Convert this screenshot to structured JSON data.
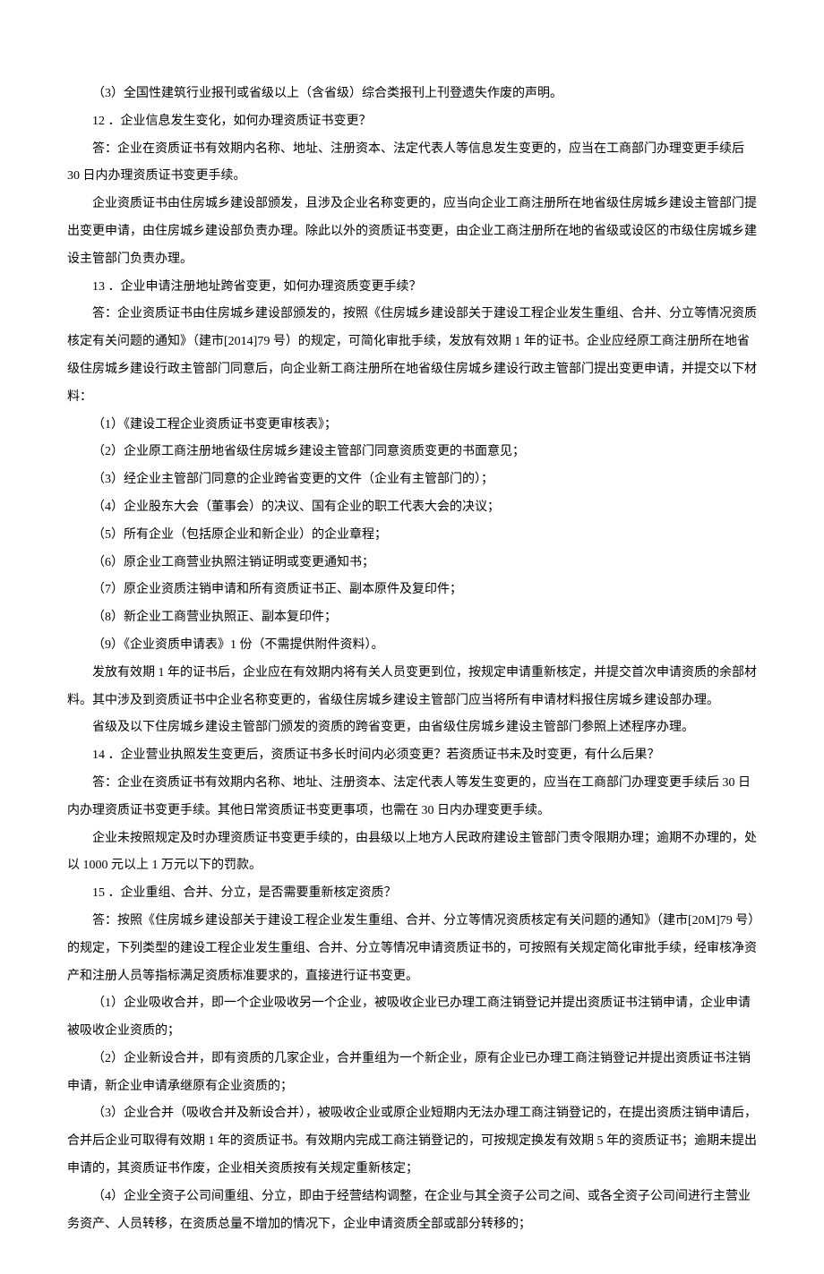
{
  "lines": [
    "（3）全国性建筑行业报刊或省级以上（含省级）综合类报刊上刊登遗失作废的声明。",
    "12 ．企业信息发生变化，如何办理资质证书变更？",
    "答：企业在资质证书有效期内名称、地址、注册资本、法定代表人等信息发生变更的，应当在工商部门办理变更手续后 30 日内办理资质证书变更手续。",
    "企业资质证书由住房城乡建设部颁发，且涉及企业名称变更的，应当向企业工商注册所在地省级住房城乡建设主管部门提出变更申请，由住房城乡建设部负责办理。除此以外的资质证书变更，由企业工商注册所在地的省级或设区的市级住房城乡建设主管部门负责办理。",
    "13 ．企业申请注册地址跨省变更，如何办理资质变更手续？",
    "答：企业资质证书由住房城乡建设部颁发的，按照《住房城乡建设部关于建设工程企业发生重组、合并、分立等情况资质核定有关问题的通知》（建市[2014]79 号）的规定，可简化审批手续，发放有效期 1 年的证书。企业应经原工商注册所在地省级住房城乡建设行政主管部门同意后，向企业新工商注册所在地省级住房城乡建设行政主管部门提出变更申请，并提交以下材料：",
    "（1）《建设工程企业资质证书变更审核表》；",
    "（2）企业原工商注册地省级住房城乡建设主管部门同意资质变更的书面意见；",
    "（3）经企业主管部门同意的企业跨省变更的文件（企业有主管部门的）；",
    "（4）企业股东大会（董事会）的决议、国有企业的职工代表大会的决议；",
    "（5）所有企业（包括原企业和新企业）的企业章程；",
    "（6）原企业工商营业执照注销证明或变更通知书；",
    "（7）原企业资质注销申请和所有资质证书正、副本原件及复印件；",
    "（8）新企业工商营业执照正、副本复印件；",
    "（9）《企业资质申请表》1 份（不需提供附件资料）。",
    "发放有效期 1 年的证书后，企业应在有效期内将有关人员变更到位，按规定申请重新核定，并提交首次申请资质的余部材料。其中涉及到资质证书中企业名称变更的，省级住房城乡建设主管部门应当将所有申请材料报住房城乡建设部办理。",
    "省级及以下住房城乡建设主管部门颁发的资质的跨省变更，由省级住房城乡建设主管部门参照上述程序办理。",
    "14 ．企业营业执照发生变更后，资质证书多长时间内必须变更？若资质证书未及时变更，有什么后果？",
    "答：企业在资质证书有效期内名称、地址、注册资本、法定代表人等发生变更的，应当在工商部门办理变更手续后 30 日内办理资质证书变更手续。其他日常资质证书变更事项，也需在 30 日内办理变更手续。",
    "企业未按照规定及时办理资质证书变更手续的，由县级以上地方人民政府建设主管部门责令限期办理；逾期不办理的，处以 1000 元以上 1 万元以下的罚款。",
    "15 ．企业重组、合并、分立，是否需要重新核定资质？",
    "答：按照《住房城乡建设部关于建设工程企业发生重组、合并、分立等情况资质核定有关问题的通知》（建市[20M]79 号）的规定，下列类型的建设工程企业发生重组、合并、分立等情况申请资质证书的，可按照有关规定简化审批手续，经审核净资产和注册人员等指标满足资质标准要求的，直接进行证书变更。",
    "（1）企业吸收合并，即一个企业吸收另一个企业，被吸收企业已办理工商注销登记并提出资质证书注销申请，企业申请被吸收企业资质的；",
    "（2）企业新设合并，即有资质的几家企业，合并重组为一个新企业，原有企业已办理工商注销登记并提出资质证书注销申请，新企业申请承继原有企业资质的；",
    "（3）企业合并（吸收合并及新设合并），被吸收企业或原企业短期内无法办理工商注销登记的，在提出资质注销申请后，合并后企业可取得有效期 1 年的资质证书。有效期内完成工商注销登记的，可按规定换发有效期 5 年的资质证书；逾期未提出申请的，其资质证书作废，企业相关资质按有关规定重新核定；",
    "（4）企业全资子公司间重组、分立，即由于经营结构调整，在企业与其全资子公司之间、或各全资子公司间进行主营业务资产、人员转移，在资质总量不增加的情况下，企业申请资质全部或部分转移的；"
  ]
}
